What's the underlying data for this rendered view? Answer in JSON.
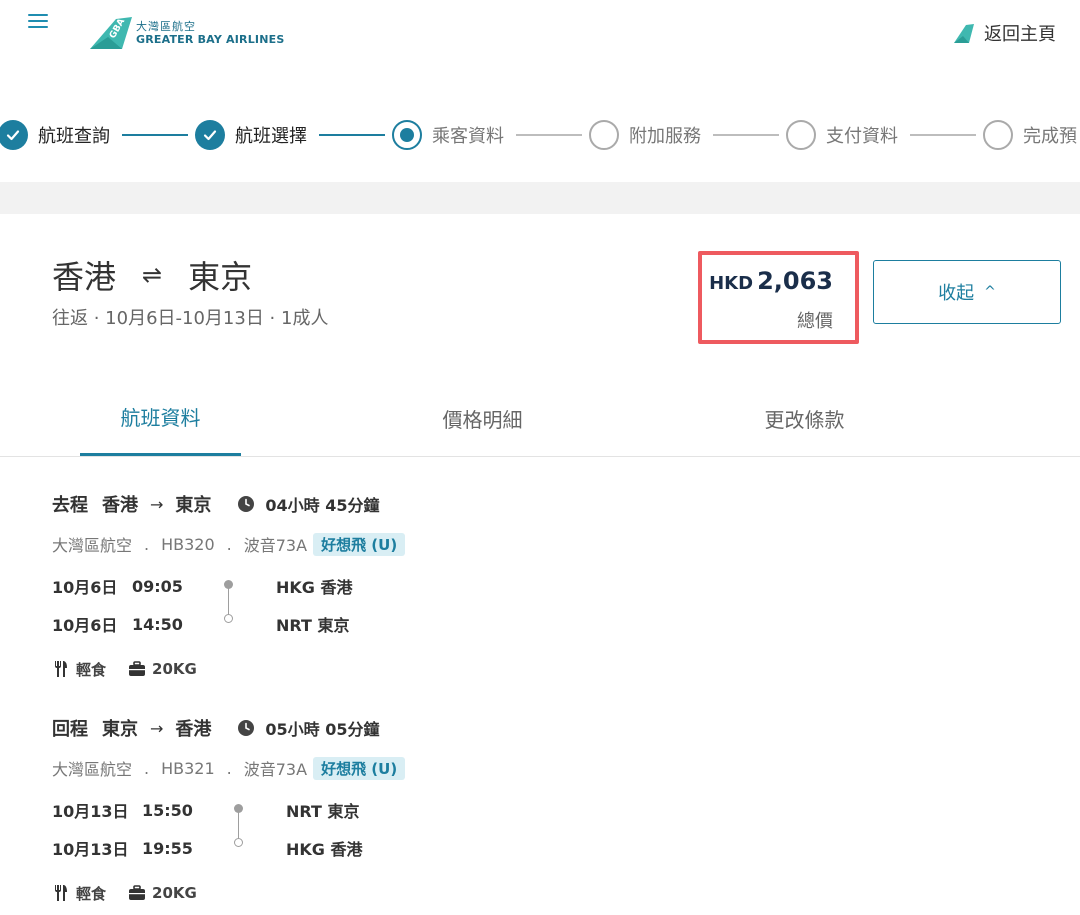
{
  "header": {
    "logo_cn": "大灣區航空",
    "logo_en": "GREATER BAY AIRLINES",
    "logo_mark": "GBA",
    "home_label": "返回主頁"
  },
  "stepper": [
    {
      "label": "航班查詢",
      "status": "done"
    },
    {
      "label": "航班選擇",
      "status": "done"
    },
    {
      "label": "乘客資料",
      "status": "current"
    },
    {
      "label": "附加服務",
      "status": "todo"
    },
    {
      "label": "支付資料",
      "status": "todo"
    },
    {
      "label": "完成預",
      "status": "todo"
    }
  ],
  "summary": {
    "origin": "香港",
    "swap_icon": "⇌",
    "destination": "東京",
    "subtitle": "往返 · 10月6日-10月13日 · 1成人",
    "currency": "HKD",
    "amount": "2,063",
    "total_label": "總價",
    "collapse_label": "收起",
    "collapse_chevron": "^"
  },
  "tabs": [
    {
      "label": "航班資料",
      "active": true
    },
    {
      "label": "價格明細",
      "active": false
    },
    {
      "label": "更改條款",
      "active": false
    }
  ],
  "legs": [
    {
      "direction": "去程",
      "from": "香港",
      "arrow": "→",
      "to": "東京",
      "duration": "04小時 45分鐘",
      "airline": "大灣區航空",
      "sep1": ".",
      "flight_no": "HB320",
      "sep2": ".",
      "aircraft": "波音73A",
      "fare": "好想飛 (U)",
      "dep_date": "10月6日",
      "dep_time": "09:05",
      "dep_airport": "HKG 香港",
      "arr_date": "10月6日",
      "arr_time": "14:50",
      "arr_airport": "NRT 東京",
      "meal": "輕食",
      "baggage": "20KG"
    },
    {
      "direction": "回程",
      "from": "東京",
      "arrow": "→",
      "to": "香港",
      "duration": "05小時 05分鐘",
      "airline": "大灣區航空",
      "sep1": ".",
      "flight_no": "HB321",
      "sep2": ".",
      "aircraft": "波音73A",
      "fare": "好想飛 (U)",
      "dep_date": "10月13日",
      "dep_time": "15:50",
      "dep_airport": "NRT 東京",
      "arr_date": "10月13日",
      "arr_time": "19:55",
      "arr_airport": "HKG 香港",
      "meal": "輕食",
      "baggage": "20KG"
    }
  ],
  "colors": {
    "primary": "#1d7e9f",
    "highlight_border": "#ee5a5f",
    "price_text": "#1a2e4a",
    "badge_bg": "#d9eef4"
  }
}
